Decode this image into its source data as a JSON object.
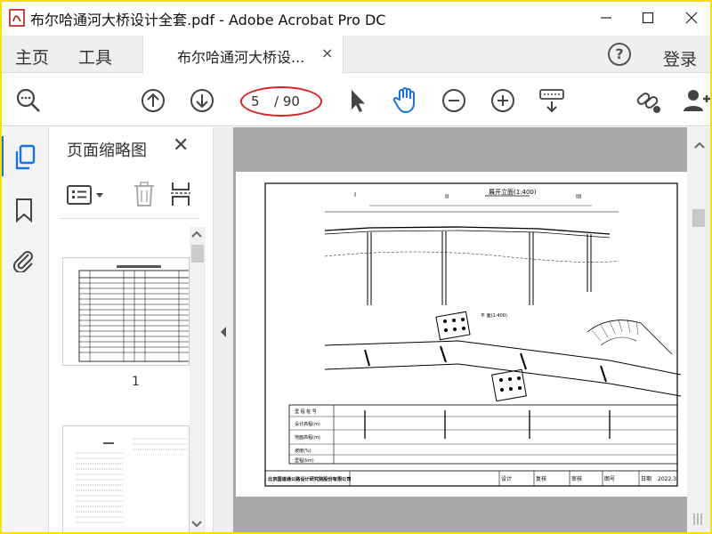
{
  "window": {
    "title": "布尔哈通河大桥设计全套.pdf - Adobe Acrobat Pro DC",
    "minimize": "—",
    "maximize": "☐",
    "close": "✕"
  },
  "menu": {
    "home": "主页",
    "tools": "工具",
    "tab_label": "布尔哈通河大桥设...",
    "tab_close": "×",
    "help": "?",
    "login": "登录"
  },
  "toolbar": {
    "page_current": "5",
    "page_total": "/ 90",
    "icons": [
      "zoom-search-icon",
      "page-up-icon",
      "page-down-icon",
      "select-arrow-icon",
      "hand-tool-icon",
      "zoom-out-icon",
      "zoom-in-icon",
      "keyboard-scroll-icon",
      "share-link-icon",
      "add-user-icon"
    ]
  },
  "sidebar": {
    "panel_title": "页面缩略图",
    "panel_close": "✕",
    "thumbnails": [
      {
        "label": "1"
      },
      {
        "label": ""
      }
    ]
  },
  "document": {
    "drawing_title": "展开立面(1:400)",
    "plan_title": "平 面(1:400)",
    "section_marks": [
      "I",
      "II",
      "III"
    ],
    "table_rows": [
      "里 程 桩 号",
      "设计高程(m)",
      "地面高程(m)",
      "坡度(%)",
      "里程(km)"
    ],
    "footer_company": "北京国道通公路设计研究院股份有限公司",
    "footer_cells": [
      "设计",
      "复核",
      "审核",
      "图号",
      "日期",
      "2022.3"
    ]
  },
  "colors": {
    "accent": "#1473e6",
    "highlight_ellipse": "#d22222",
    "frame": "#f5e100",
    "canvas": "#a9a9a9"
  }
}
